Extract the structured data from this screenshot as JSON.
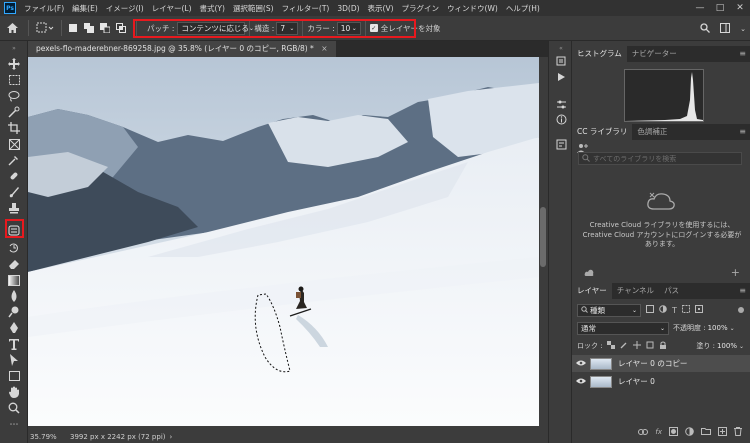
{
  "app": {
    "logo": "Ps"
  },
  "menu": [
    "ファイル(F)",
    "編集(E)",
    "イメージ(I)",
    "レイヤー(L)",
    "書式(Y)",
    "選択範囲(S)",
    "フィルター(T)",
    "3D(D)",
    "表示(V)",
    "プラグイン",
    "ウィンドウ(W)",
    "ヘルプ(H)"
  ],
  "options": {
    "patch_label": "パッチ :",
    "patch_value": "コンテンツに応じる",
    "structure_label": "構造 :",
    "structure_value": "7",
    "color_label": "カラー :",
    "color_value": "10",
    "all_layers_label": "全レイヤーを対象",
    "all_layers_checked": true
  },
  "document": {
    "tab_title": "pexels-flo-maderebner-869258.jpg @ 35.8% (レイヤー 0 のコピー, RGB/8) *",
    "zoom": "35.79%",
    "size_info": "3992 px x 2242 px (72 ppi)"
  },
  "panels": {
    "histogram": {
      "tabs": [
        "ヒストグラム",
        "ナビゲーター"
      ]
    },
    "library": {
      "tabs": [
        "CC ライブラリ",
        "色調補正"
      ],
      "search_placeholder": "すべてのライブラリを検索",
      "message": "Creative Cloud ライブラリを使用するには、Creative Cloud アカウントにログインする必要があります。"
    },
    "layers": {
      "tabs": [
        "レイヤー",
        "チャンネル",
        "パス"
      ],
      "kind_filter": "種類",
      "blend_mode": "通常",
      "opacity_label": "不透明度 :",
      "opacity_value": "100%",
      "lock_label": "ロック :",
      "fill_label": "塗り :",
      "fill_value": "100%",
      "items": [
        {
          "name": "レイヤー 0 のコピー",
          "selected": true
        },
        {
          "name": "レイヤー 0",
          "selected": false
        }
      ]
    }
  },
  "colors": {
    "accent_highlight": "#e8191e",
    "panel_bg": "#3c3c3c",
    "app_bg": "#323232"
  }
}
